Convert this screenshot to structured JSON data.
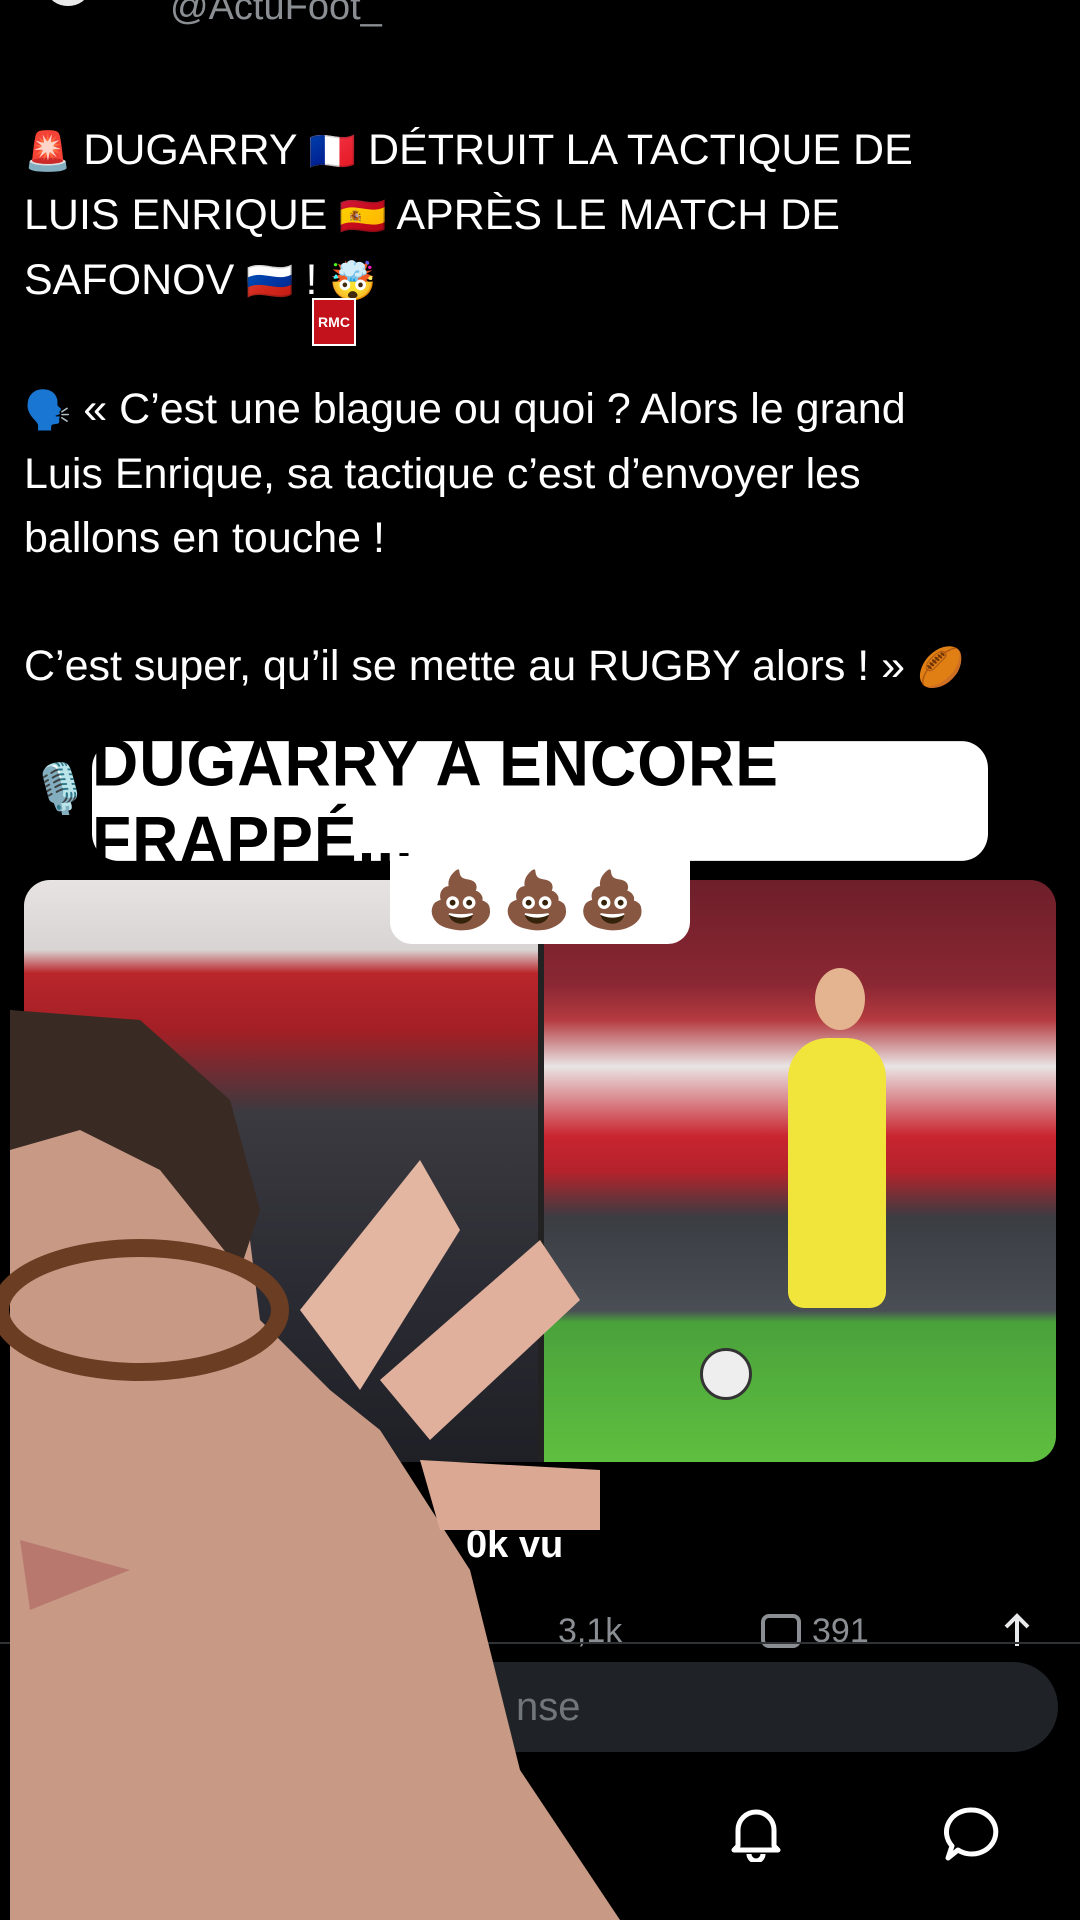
{
  "header": {
    "handle": "@ActuFoot_"
  },
  "tweet": {
    "line1_icon": "🚨",
    "line1a": "DUGARRY",
    "flag_fr": "🇫🇷",
    "line1b": "DÉTRUIT LA TACTIQUE DE",
    "line2a": "LUIS ENRIQUE",
    "flag_es": "🇪🇸",
    "line2b": "APRÈS LE MATCH DE",
    "line3a": "SAFONOV",
    "flag_ru": "🇷🇺",
    "line3b": "!",
    "line3_emoji": "🤯",
    "quote_icon": "🗣️",
    "quote1": "« C’est une blague ou quoi ?  Alors le grand",
    "quote2": "Luis Enrique, sa tactique c’est d’envoyer les",
    "quote3": "ballons en touche !",
    "quote4": "C’est super, qu’il se mette au RUGBY alors ! »",
    "rugby_emoji": "🏉"
  },
  "overlay": {
    "mic_icon": "🎙️",
    "title": "DUGARRY A ENCORE FRAPPÉ...",
    "emojis": "💩💩💩"
  },
  "media": {
    "rmc_label": "RMC"
  },
  "stats": {
    "views": "0k vu",
    "reposts": "3,1k",
    "replies": "391"
  },
  "reply_box": {
    "placeholder": "nse"
  },
  "icons": {
    "bell": "bell-icon",
    "chat": "chat-bubble-icon",
    "share": "share-icon",
    "reply": "reply-icon"
  }
}
